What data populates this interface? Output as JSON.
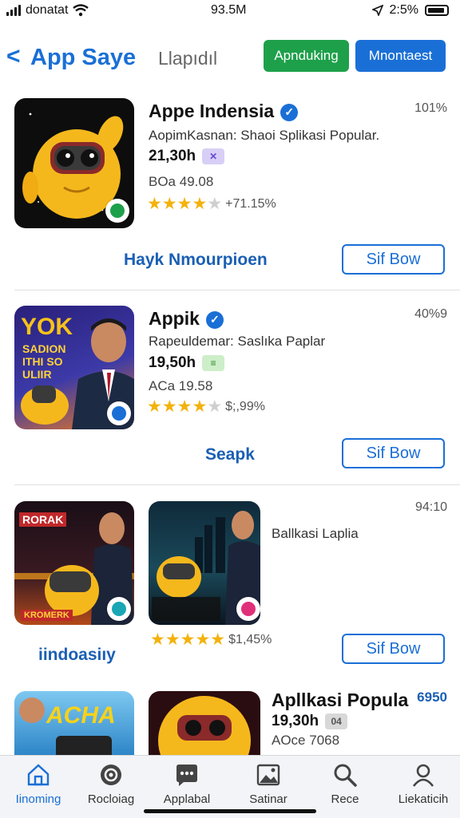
{
  "status_bar": {
    "carrier": "donatat",
    "time": "93.5M",
    "battery": "2:5%"
  },
  "nav": {
    "back_glyph": "<",
    "title": "App Saye",
    "subtitle": "Llapıdıl",
    "btn_green": "Apnduking",
    "btn_blue": "Mnontaest"
  },
  "apps": [
    {
      "name": "Appe Indensia",
      "desc": "AopimKasnan: Shaoi Splikasi Popular.",
      "size": "21,30h",
      "badge": "✕",
      "meta": "BOa 49.08",
      "rating": 3.5,
      "reviews": "+71.15%",
      "percent": "101%",
      "link": "Hayk Nmourpioen",
      "action": "Sif Bow"
    },
    {
      "name": "Appik",
      "desc": "Rapeuldemar: Saslıka Paplar",
      "size": "19,50h",
      "badge": "≡",
      "meta": "ACa 19.58",
      "rating": 3.5,
      "reviews": "$;,99%",
      "percent": "40%9",
      "link": "Seapk",
      "action": "Sif Bow"
    },
    {
      "name": "",
      "desc": "Ballkasi Laplia",
      "rating": 4.5,
      "reviews": "$1,45%",
      "percent": "94:10",
      "link": "iindoasiıy",
      "action": "Sif Bow"
    },
    {
      "name": "Apllkasi Popula",
      "size": "19,30h",
      "badge": "04",
      "meta": "AOce 7068",
      "percent": "6950"
    }
  ],
  "tile_text": {
    "yok": "YOK",
    "sadion": "SADION ITHI SO ULIIR",
    "rorak": "RORAK",
    "kromerk": "KROMERK",
    "acha": "ACHA"
  },
  "tabs": [
    {
      "label": "Iinoming",
      "icon": "home-icon"
    },
    {
      "label": "Rocloiag",
      "icon": "settings-icon"
    },
    {
      "label": "Applabal",
      "icon": "chat-icon"
    },
    {
      "label": "Satinar",
      "icon": "gallery-icon"
    },
    {
      "label": "Rece",
      "icon": "search-icon"
    },
    {
      "label": "Liekaticih",
      "icon": "profile-icon"
    }
  ],
  "colors": {
    "accent": "#1a6fd6",
    "green": "#1ea04a",
    "star": "#f3b20c"
  }
}
